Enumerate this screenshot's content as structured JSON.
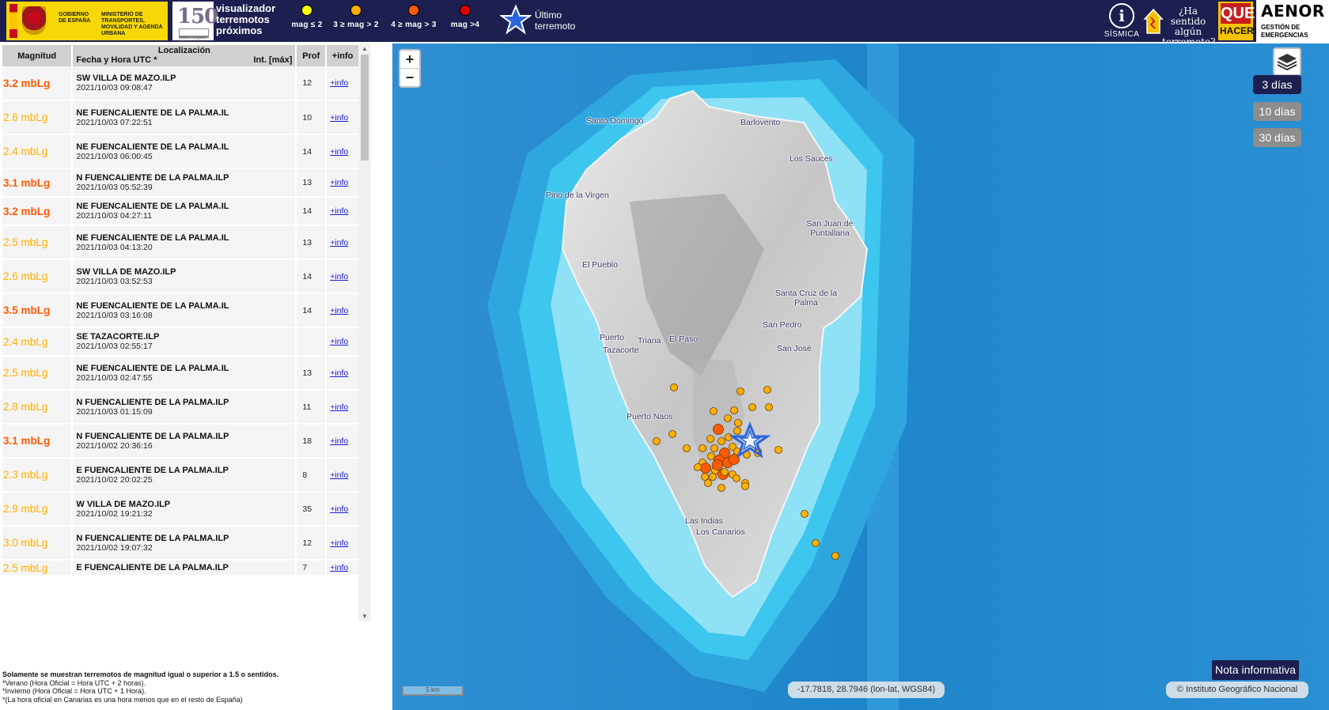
{
  "header": {
    "gov_text_1": "GOBIERNO DE ESPAÑA",
    "gov_text_2": "MINISTERIO DE TRANSPORTES, MOVILIDAD Y AGENDA URBANA",
    "anniv_number": "150",
    "anniv_caption": "Instituto Geográfico Nacional 1870-2020",
    "viewer_title_1": "visualizador",
    "viewer_title_2": "terremotos",
    "viewer_title_3": "próximos",
    "legend": [
      {
        "label": "mag ≤ 2",
        "color": "#ffff00"
      },
      {
        "label": "3 ≥ mag > 2",
        "color": "#ffb000"
      },
      {
        "label": "4 ≥ mag > 3",
        "color": "#ff5a00"
      },
      {
        "label": "mag >4",
        "color": "#e00000"
      }
    ],
    "latest_label_1": "Último",
    "latest_label_2": "terremoto",
    "sismica_label": "SÍSMICA",
    "felt_text": "¿Ha sentido algún terremoto?",
    "que_label": "QUE",
    "hacer_label": "HACER?",
    "aenor_label": "AENOR",
    "aenor_sub": "GESTIÓN DE EMERGENCIAS"
  },
  "table": {
    "headers": {
      "magnitude": "Magnitud",
      "location": "Localización",
      "datetime": "Fecha y Hora UTC *",
      "intensity": "Int. [máx]",
      "depth": "Prof",
      "info": "+info"
    },
    "rows": [
      {
        "mag": "3.2 mbLg",
        "place": "SW VILLA DE MAZO.ILP",
        "date": "2021/10/03 09:08:47",
        "prof": "12",
        "info": "+info",
        "color": "#ff5a00"
      },
      {
        "mag": "2.6 mbLg",
        "place": "NE FUENCALIENTE DE LA PALMA.IL",
        "date": "2021/10/03 07:22:51",
        "prof": "10",
        "info": "+info",
        "color": "#ffb000"
      },
      {
        "mag": "2.4 mbLg",
        "place": "NE FUENCALIENTE DE LA PALMA.IL",
        "date": "2021/10/03 06:00:45",
        "prof": "14",
        "info": "+info",
        "color": "#ffb000"
      },
      {
        "mag": "3.1 mbLg",
        "place": "N FUENCALIENTE DE LA PALMA.ILP",
        "date": "2021/10/03 05:52:39",
        "prof": "13",
        "info": "+info",
        "color": "#ff5a00"
      },
      {
        "mag": "3.2 mbLg",
        "place": "NE FUENCALIENTE DE LA PALMA.IL",
        "date": "2021/10/03 04:27:11",
        "prof": "14",
        "info": "+info",
        "color": "#ff5a00"
      },
      {
        "mag": "2.5 mbLg",
        "place": "NE FUENCALIENTE DE LA PALMA.IL",
        "date": "2021/10/03 04:13:20",
        "prof": "13",
        "info": "+info",
        "color": "#ffb000"
      },
      {
        "mag": "2.6 mbLg",
        "place": "SW VILLA DE MAZO.ILP",
        "date": "2021/10/03 03:52:53",
        "prof": "14",
        "info": "+info",
        "color": "#ffb000"
      },
      {
        "mag": "3.5 mbLg",
        "place": "NE FUENCALIENTE DE LA PALMA.IL",
        "date": "2021/10/03 03:16:08",
        "prof": "14",
        "info": "+info",
        "color": "#ff5a00"
      },
      {
        "mag": "2.4 mbLg",
        "place": "SE TAZACORTE.ILP",
        "date": "2021/10/03 02:55:17",
        "prof": "",
        "info": "+info",
        "color": "#ffb000"
      },
      {
        "mag": "2.5 mbLg",
        "place": "NE FUENCALIENTE DE LA PALMA.IL",
        "date": "2021/10/03 02:47:55",
        "prof": "13",
        "info": "+info",
        "color": "#ffb000"
      },
      {
        "mag": "2.8 mbLg",
        "place": "N FUENCALIENTE DE LA PALMA.ILP",
        "date": "2021/10/03 01:15:09",
        "prof": "11",
        "info": "+info",
        "color": "#ffb000"
      },
      {
        "mag": "3.1 mbLg",
        "place": "N FUENCALIENTE DE LA PALMA.ILP",
        "date": "2021/10/02 20:36:16",
        "prof": "18",
        "info": "+info",
        "color": "#ff5a00"
      },
      {
        "mag": "2.3 mbLg",
        "place": "E FUENCALIENTE DE LA PALMA.ILP",
        "date": "2021/10/02 20:02:25",
        "prof": "8",
        "info": "+info",
        "color": "#ffb000"
      },
      {
        "mag": "2.9 mbLg",
        "place": "W VILLA DE MAZO.ILP",
        "date": "2021/10/02 19:21:32",
        "prof": "35",
        "info": "+info",
        "color": "#ffb000"
      },
      {
        "mag": "3.0 mbLg",
        "place": "N FUENCALIENTE DE LA PALMA.ILP",
        "date": "2021/10/02 19:07:32",
        "prof": "12",
        "info": "+info",
        "color": "#ffb000"
      },
      {
        "mag": "2.5 mbLg",
        "place": "E FUENCALIENTE DE LA PALMA.ILP",
        "date": "",
        "prof": "7",
        "info": "+info",
        "color": "#ffb000"
      }
    ]
  },
  "notes": {
    "line1": "Solamente se muestran terremotos de magnitud igual o superior a 1.5 o sentidos.",
    "line2": "*Verano (Hora Oficial = Hora UTC + 2 horas).",
    "line3": "*Invierno (Hora Oficial = Hora UTC + 1 Hora).",
    "line4": "*(La hora oficial en Canarias es una hora menos que en el resto de España)"
  },
  "map": {
    "zoom_in": "+",
    "zoom_out": "−",
    "days": [
      {
        "label": "3 días",
        "active": true
      },
      {
        "label": "10 días",
        "active": false
      },
      {
        "label": "30 días",
        "active": false
      }
    ],
    "nota_label": "Nota informativa",
    "coords_text": "-17.7818, 28.7946 (lon-lat, WGS84)",
    "attribution": "© Instituto Geográfico Nacional",
    "scale_label": "5 km",
    "places": [
      "Santo Domingo",
      "Barlovento",
      "Los Sauces",
      "Pino de la Virgen",
      "San Juan de Puntallana",
      "El Pueblo",
      "Santa Cruz de la Palma",
      "San Pedro",
      "San José",
      "Puerto",
      "Tazacorte",
      "Triana",
      "El Paso",
      "Puerto Naos",
      "Las Indias",
      "Los Canarios"
    ],
    "colors": {
      "ocean_deep": "#1a7fc4",
      "ocean_shelf": "#3dc6ee",
      "shelf_light": "#8fe1f6",
      "land": "#dcdcdc",
      "quake_mid": "#ffb000",
      "quake_high": "#ff5a00",
      "star": "#1f63d6"
    }
  }
}
